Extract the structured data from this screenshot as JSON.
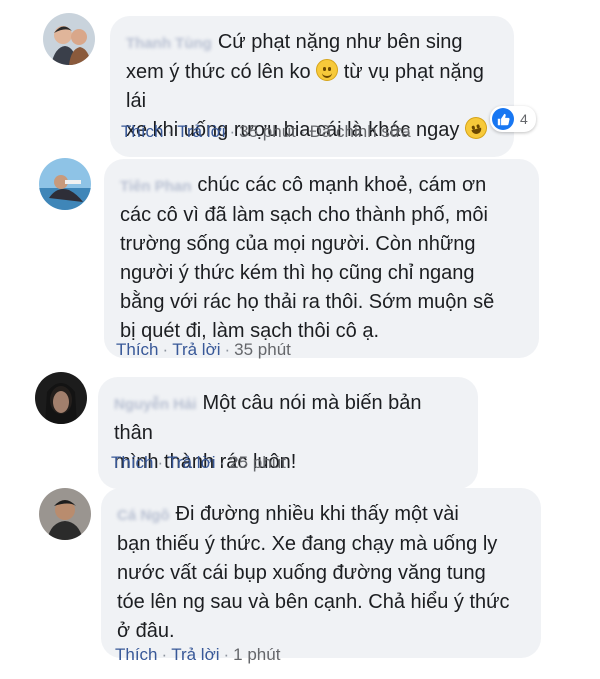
{
  "comments": [
    {
      "author": "Thanh Tùng",
      "text_1": "Cứ phạt nặng như bên sing",
      "text_2": "xem ý thức có lên ko",
      "text_3": "từ vụ phạt nặng lái",
      "text_4": "xe khi uống rượu bia cái là khác ngay",
      "reactions": {
        "icon": "like-icon",
        "count": "4"
      },
      "actions": {
        "like": "Thích",
        "reply": "Trả lời",
        "time": "35 phút",
        "edited": "Đã chỉnh sửa"
      }
    },
    {
      "author": "Tiên Phan",
      "text_1": "chúc các cô mạnh khoẻ, cám ơn",
      "text_2": "các cô vì đã làm sạch cho thành phố, môi",
      "text_3": "trường sống của mọi người. Còn những",
      "text_4": "người ý thức kém thì họ cũng chỉ ngang",
      "text_5": "bằng với rác họ thải ra thôi. Sớm muộn sẽ",
      "text_6": "bị quét đi, làm sạch thôi cô ạ.",
      "actions": {
        "like": "Thích",
        "reply": "Trả lời",
        "time": "35 phút"
      }
    },
    {
      "author": "Nguyễn Hải",
      "text_1": "Một câu nói mà biến bản thân",
      "text_2": "mình thành rác luôn!",
      "actions": {
        "like": "Thích",
        "reply": "Trả lời",
        "time": "25 phút"
      }
    },
    {
      "author": "Cá Ngô",
      "text_1": "Đi đường nhiều khi thấy một vài",
      "text_2": "bạn thiếu ý thức. Xe đang chạy mà uống ly",
      "text_3": "nước vất cái bụp xuống đường văng tung",
      "text_4": "tóe lên ng sau và bên cạnh. Chả hiểu ý thức",
      "text_5": "ở đâu.",
      "actions": {
        "like": "Thích",
        "reply": "Trả lời",
        "time": "1 phút"
      }
    }
  ]
}
